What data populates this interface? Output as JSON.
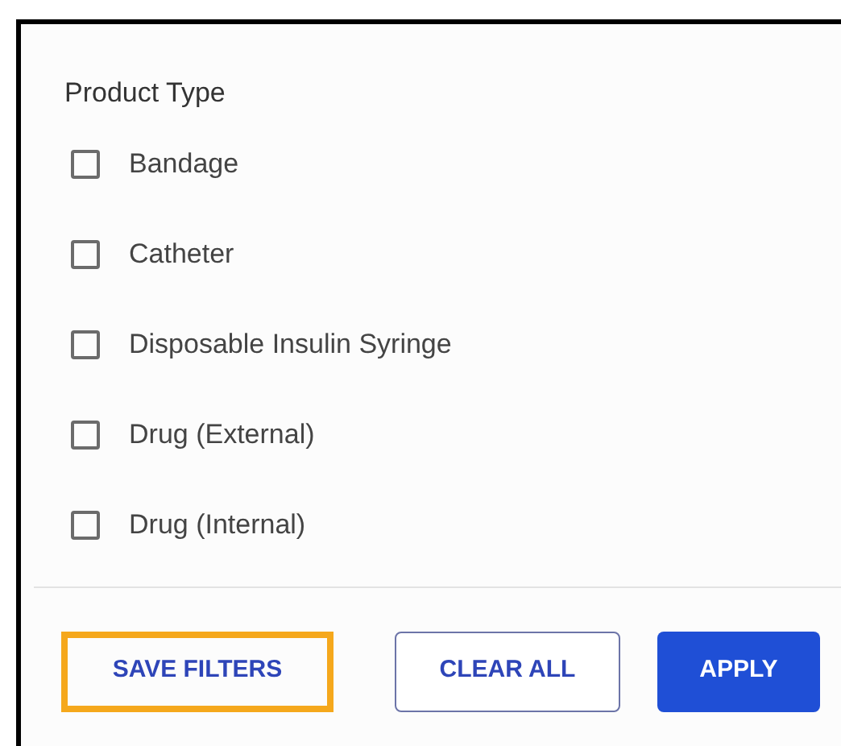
{
  "section": {
    "title": "Product Type"
  },
  "options": [
    {
      "label": "Bandage",
      "checked": false
    },
    {
      "label": "Catheter",
      "checked": false
    },
    {
      "label": "Disposable Insulin Syringe",
      "checked": false
    },
    {
      "label": "Drug (External)",
      "checked": false
    },
    {
      "label": "Drug (Internal)",
      "checked": false
    }
  ],
  "buttons": [
    {
      "label": "SAVE FILTERS",
      "kind": "text",
      "highlighted": true
    },
    {
      "label": "CLEAR ALL",
      "kind": "outlined",
      "highlighted": false
    },
    {
      "label": "APPLY",
      "kind": "filled",
      "highlighted": false
    }
  ]
}
